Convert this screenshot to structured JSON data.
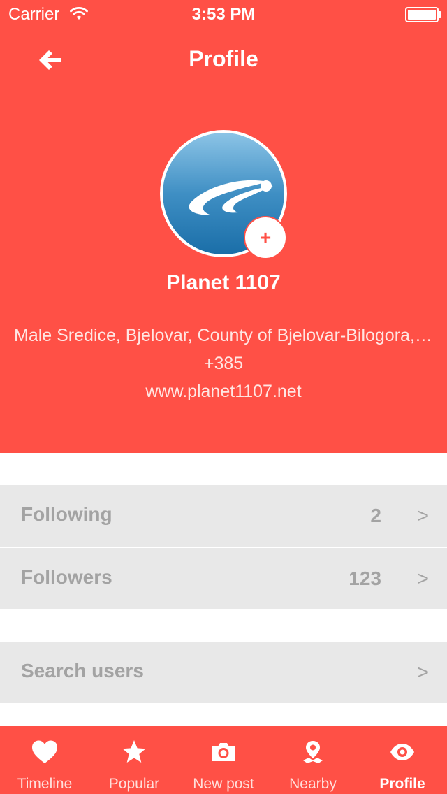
{
  "status_bar": {
    "carrier": "Carrier",
    "time": "3:53 PM"
  },
  "nav": {
    "title": "Profile",
    "back_icon": "arrow-left-icon"
  },
  "profile": {
    "name": "Planet 1107",
    "location": "Male Sredice, Bjelovar, County of Bjelovar-Bilogora, Croatia",
    "phone": "+385",
    "website": "www.planet1107.net",
    "add_button_label": "+"
  },
  "rows": {
    "following": {
      "label": "Following",
      "count": "2",
      "chevron": ">"
    },
    "followers": {
      "label": "Followers",
      "count": "123",
      "chevron": ">"
    },
    "search": {
      "label": "Search users",
      "chevron": ">"
    }
  },
  "tabbar": {
    "items": [
      {
        "label": "Timeline",
        "icon": "heart-icon"
      },
      {
        "label": "Popular",
        "icon": "star-icon"
      },
      {
        "label": "New post",
        "icon": "camera-icon"
      },
      {
        "label": "Nearby",
        "icon": "map-pin-icon"
      },
      {
        "label": "Profile",
        "icon": "eye-icon"
      }
    ],
    "active": "Profile"
  },
  "colors": {
    "accent": "#ff5046",
    "row_background": "#e8e8e8",
    "row_text": "#a3a3a3"
  }
}
